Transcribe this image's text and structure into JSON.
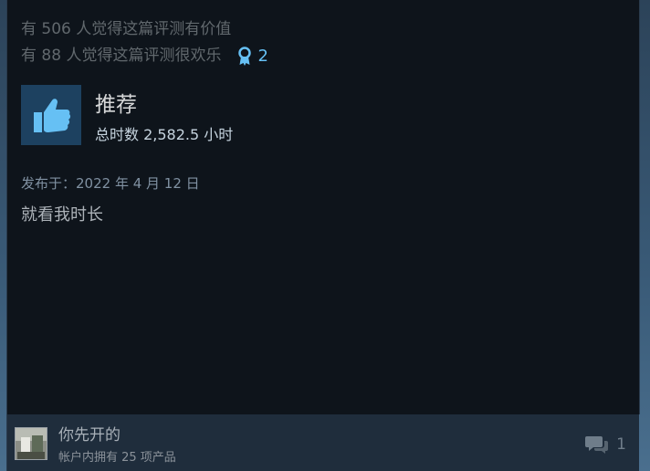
{
  "review": {
    "helpful_text": "有 506 人觉得这篇评测有价值",
    "funny_text": "有 88 人觉得这篇评测很欢乐",
    "award_count": "2",
    "verdict": "推荐",
    "playtime": "总时数 2,582.5 小时",
    "posted": "发布于：2022 年 4 月 12 日",
    "body": "就看我时长"
  },
  "author": {
    "name": "你先开的",
    "products": "帐户内拥有 25 项产品"
  },
  "comments": {
    "count": "1"
  },
  "icons": {
    "award": "award-ribbon-icon",
    "thumb": "thumbs-up-icon",
    "comment": "comment-bubbles-icon"
  },
  "colors": {
    "card_bg": "#0e141b",
    "accent_blue": "#66c0f4",
    "thumb_bg": "#1d4160",
    "footer_bg": "#1f2d3c"
  }
}
